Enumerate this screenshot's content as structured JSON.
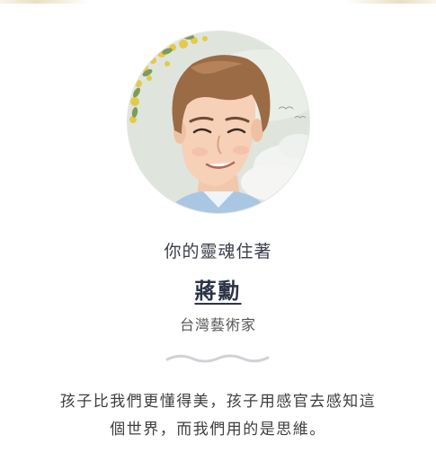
{
  "profile": {
    "subtitle": "你的靈魂住著",
    "name": "蔣勳",
    "role": "台灣藝術家"
  },
  "quote": {
    "line1": "孩子比我們更懂得美，孩子用感官去感知這",
    "line2": "個世界，而我們用的是思維。"
  },
  "icons": {
    "avatar": "portrait-illustration",
    "divider": "wave-divider-icon"
  },
  "colors": {
    "name_text": "#2c3346",
    "body_text": "#3e3e3e",
    "divider": "#cfd2d6",
    "avatar_bg": "#dfe5dd"
  }
}
